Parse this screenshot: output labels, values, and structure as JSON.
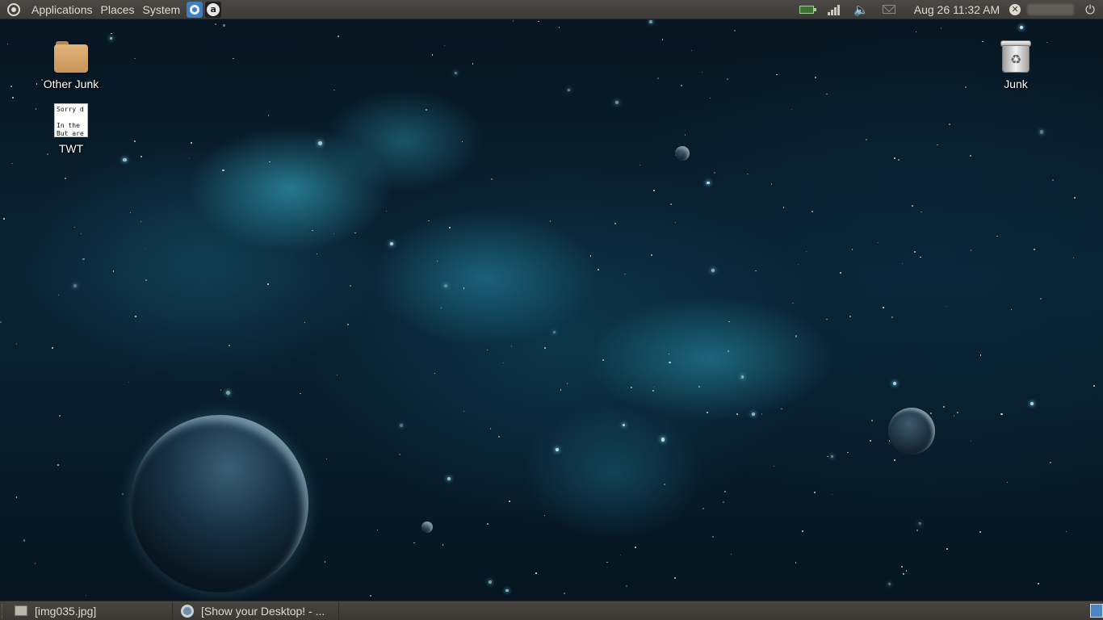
{
  "top_panel": {
    "menus": [
      "Applications",
      "Places",
      "System"
    ],
    "launchers": [
      "chromium-icon",
      "a-icon"
    ],
    "a_launcher_glyph": "a",
    "tray": {
      "icons": [
        "battery-icon",
        "network-signal-icon",
        "volume-icon",
        "mail-icon"
      ],
      "clock": "Aug 26 11:32 AM",
      "me_glyph": "✕",
      "power_glyph": "⏻"
    }
  },
  "desktop": {
    "icons": [
      {
        "label": "Other Junk",
        "icon": "folder-icon"
      },
      {
        "label": "TWT",
        "icon": "text-document-icon",
        "preview_text": "Sorry d\n\nIn the \nBut are"
      },
      {
        "label": "Junk",
        "icon": "trash-icon",
        "glyph": "♻"
      }
    ]
  },
  "bottom_panel": {
    "tasks": [
      {
        "label": "[img035.jpg]",
        "icon": "image-viewer-icon"
      },
      {
        "label": "[Show your Desktop! - ...",
        "icon": "chromium-icon"
      }
    ],
    "workspace_switcher": "workspace-icon"
  },
  "colors": {
    "panel": "#3c3b37",
    "panel_text": "#dfdbd2",
    "wallpaper_nebula": "#3ebed7",
    "workspace_active": "#4d86c2"
  }
}
